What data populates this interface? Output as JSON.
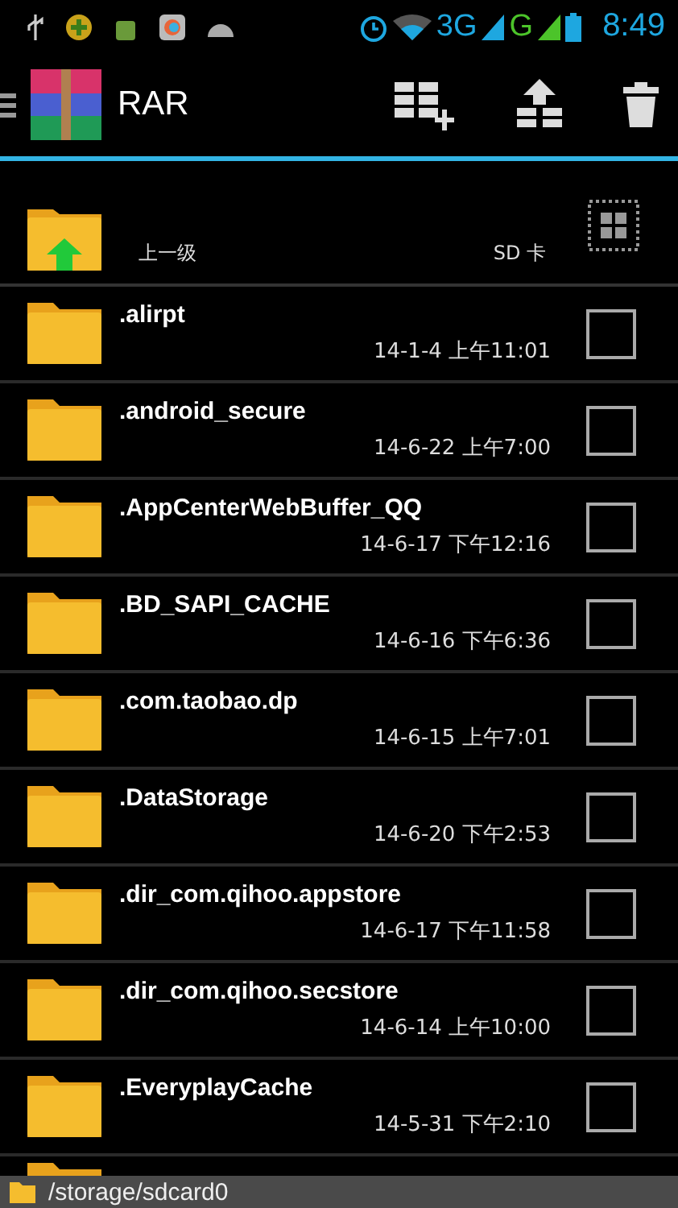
{
  "status_bar": {
    "network_3g": "3G",
    "network_g": "G",
    "time": "8:49"
  },
  "app_bar": {
    "title": "RAR"
  },
  "parent_row": {
    "label": "上一级",
    "storage": "SD 卡"
  },
  "files": [
    {
      "name": ".alirpt",
      "date": "14-1-4 上午11:01",
      "checked": false
    },
    {
      "name": ".android_secure",
      "date": "14-6-22 上午7:00",
      "checked": false
    },
    {
      "name": ".AppCenterWebBuffer_QQ",
      "date": "14-6-17 下午12:16",
      "checked": false
    },
    {
      "name": ".BD_SAPI_CACHE",
      "date": "14-6-16 下午6:36",
      "checked": false
    },
    {
      "name": ".com.taobao.dp",
      "date": "14-6-15 上午7:01",
      "checked": false
    },
    {
      "name": ".DataStorage",
      "date": "14-6-20 下午2:53",
      "checked": false
    },
    {
      "name": ".dir_com.qihoo.appstore",
      "date": "14-6-17 下午11:58",
      "checked": false
    },
    {
      "name": ".dir_com.qihoo.secstore",
      "date": "14-6-14 上午10:00",
      "checked": false
    },
    {
      "name": ".EveryplayCache",
      "date": "14-5-31 下午2:10",
      "checked": false
    }
  ],
  "path_bar": {
    "path": "/storage/sdcard0"
  }
}
